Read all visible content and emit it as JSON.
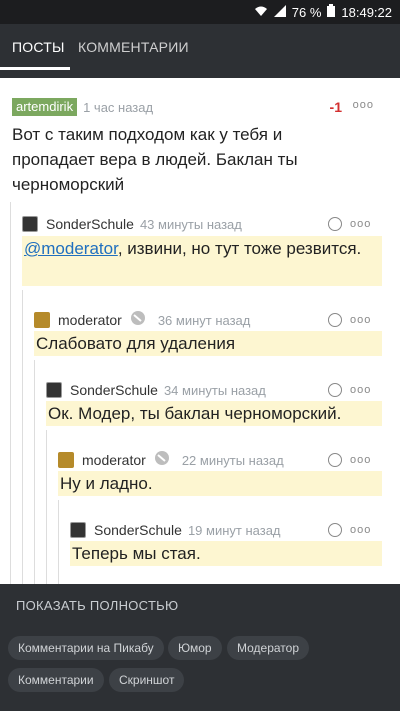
{
  "status": {
    "battery": "76 %",
    "time": "18:49:22"
  },
  "tabs": [
    {
      "label": "ПОСТЫ"
    },
    {
      "label": "КОММЕНТАРИИ"
    }
  ],
  "comments": [
    {
      "author": "artemdirik",
      "time": "1 час назад",
      "rating": "-1",
      "text": "Вот с таким подходом как у тебя и пропадает вера в людей. Баклан ты черноморский"
    },
    {
      "author": "SonderSchule",
      "time": "43 минуты назад",
      "mention": "@moderator",
      "text_rest": ", извини, но тут тоже резвится."
    },
    {
      "author": "moderator",
      "time": "36 минут назад",
      "text": "Слабовато для удаления"
    },
    {
      "author": "SonderSchule",
      "time": "34 минуты назад",
      "text": "Ок. Модер, ты баклан черноморский."
    },
    {
      "author": "moderator",
      "time": "22 минуты назад",
      "text": "Ну и ладно."
    },
    {
      "author": "SonderSchule",
      "time": "19 минут назад",
      "text": "Теперь мы стая."
    }
  ],
  "show_all": "ПОКАЗАТЬ ПОЛНОСТЬЮ",
  "tags": [
    "Комментарии на Пикабу",
    "Юмор",
    "Модератор",
    "Комментарии",
    "Скриншот"
  ],
  "dots": "ooo"
}
